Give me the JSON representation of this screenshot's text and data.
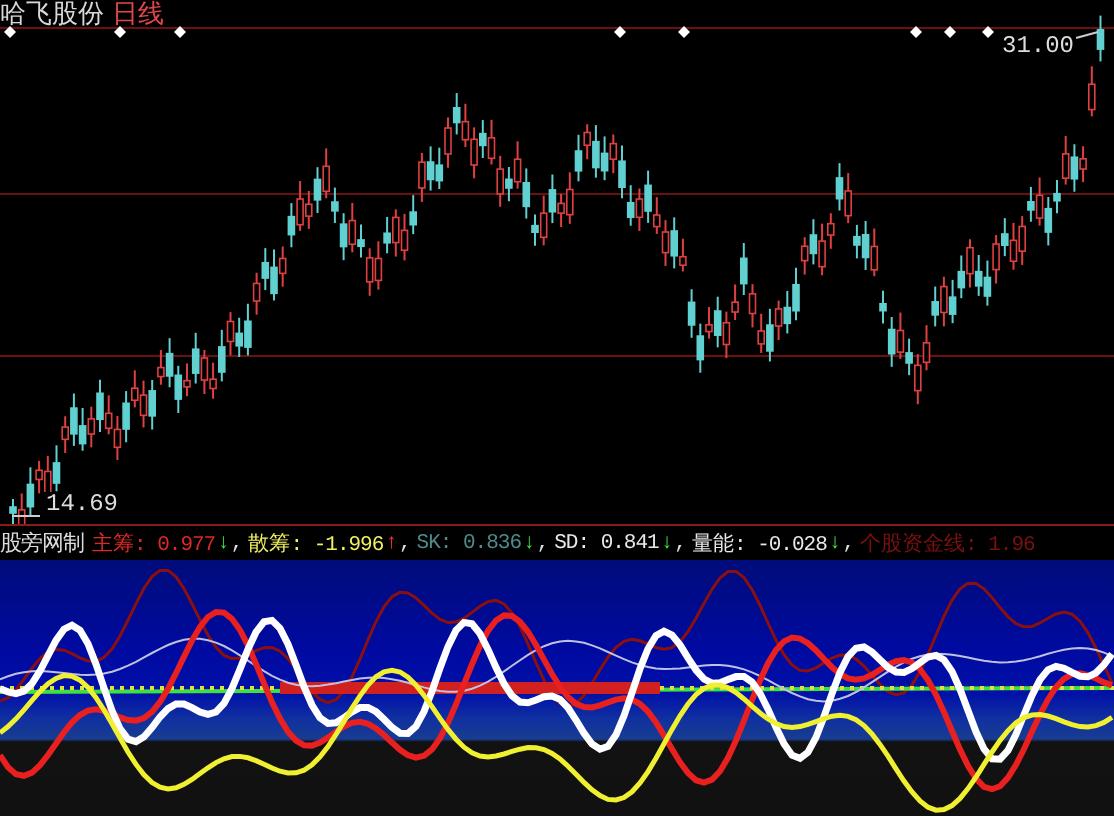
{
  "title": {
    "stock": "哈飞股份",
    "period": "日线"
  },
  "price_labels": {
    "high": "31.00",
    "low": "14.69"
  },
  "indicator": {
    "name": "股旁网制",
    "lines": [
      {
        "text": "主筹: 0.977",
        "arrow": "↓",
        "rising": false,
        "separator": ",",
        "color": "#e02828"
      },
      {
        "text": "散筹: -1.996",
        "arrow": "↑",
        "rising": true,
        "separator": ",",
        "color": "#f0f060"
      },
      {
        "text": "SK: 0.836",
        "arrow": "↓",
        "rising": false,
        "separator": ",",
        "color": "#4f8a8a"
      },
      {
        "text": "SD: 0.841",
        "arrow": "↓",
        "rising": false,
        "separator": ",",
        "color": "#e8e8e8"
      },
      {
        "text": "量能: -0.028",
        "arrow": "↓",
        "rising": false,
        "separator": ",",
        "color": "#e8e8e8"
      },
      {
        "text": "个股资金线: 1.96",
        "color": "#7a1010"
      }
    ]
  }
}
